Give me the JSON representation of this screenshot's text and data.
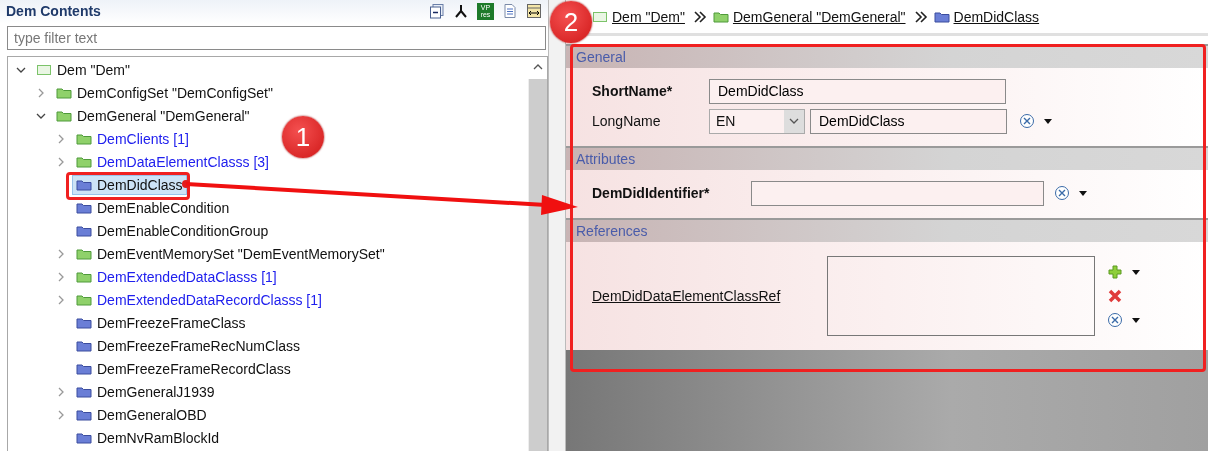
{
  "contents_panel": {
    "title": "Dem Contents",
    "toolbar_badge": [
      "VP",
      "res"
    ],
    "filter": {
      "placeholder": "type filter text"
    },
    "tree": [
      {
        "label": "Dem \"Dem\"",
        "kind": "module",
        "expanded": true,
        "linked": false,
        "selected": false,
        "children": [
          {
            "label": "DemConfigSet \"DemConfigSet\"",
            "kind": "container",
            "expanded": false,
            "linked": false,
            "selected": false
          },
          {
            "label": "DemGeneral \"DemGeneral\"",
            "kind": "container",
            "expanded": true,
            "linked": false,
            "selected": false,
            "children": [
              {
                "label": "DemClients [1]",
                "kind": "container",
                "expanded": false,
                "linked": true,
                "selected": false
              },
              {
                "label": "DemDataElementClasss [3]",
                "kind": "container",
                "expanded": false,
                "linked": true,
                "selected": false
              },
              {
                "label": "DemDidClass",
                "kind": "class",
                "linked": false,
                "selected": true
              },
              {
                "label": "DemEnableCondition",
                "kind": "class",
                "linked": false,
                "selected": false
              },
              {
                "label": "DemEnableConditionGroup",
                "kind": "class",
                "linked": false,
                "selected": false
              },
              {
                "label": "DemEventMemorySet \"DemEventMemorySet\"",
                "kind": "container",
                "expanded": false,
                "linked": false,
                "selected": false
              },
              {
                "label": "DemExtendedDataClasss [1]",
                "kind": "container",
                "expanded": false,
                "linked": true,
                "selected": false
              },
              {
                "label": "DemExtendedDataRecordClasss [1]",
                "kind": "container",
                "expanded": false,
                "linked": true,
                "selected": false
              },
              {
                "label": "DemFreezeFrameClass",
                "kind": "class",
                "linked": false,
                "selected": false
              },
              {
                "label": "DemFreezeFrameRecNumClass",
                "kind": "class",
                "linked": false,
                "selected": false
              },
              {
                "label": "DemFreezeFrameRecordClass",
                "kind": "class",
                "linked": false,
                "selected": false
              },
              {
                "label": "DemGeneralJ1939",
                "kind": "class",
                "expanded": false,
                "linked": false,
                "selected": false
              },
              {
                "label": "DemGeneralOBD",
                "kind": "class",
                "expanded": false,
                "linked": false,
                "selected": false
              },
              {
                "label": "DemNvRamBlockId",
                "kind": "class",
                "linked": false,
                "selected": false
              }
            ]
          }
        ]
      }
    ]
  },
  "editor": {
    "breadcrumb": [
      {
        "label": "Dem \"Dem\"",
        "kind": "module"
      },
      {
        "label": "DemGeneral \"DemGeneral\"",
        "kind": "container"
      },
      {
        "label": "DemDidClass",
        "kind": "class"
      }
    ],
    "sections": [
      {
        "title": "General",
        "rows": [
          {
            "kind": "text",
            "label": "ShortName*",
            "required": true,
            "value": "DemDidClass"
          },
          {
            "kind": "lang_text",
            "label": "LongName",
            "required": false,
            "language": "EN",
            "value": "DemDidClass"
          }
        ]
      },
      {
        "title": "Attributes",
        "rows": [
          {
            "kind": "number",
            "label": "DemDidIdentifier*",
            "required": true
          }
        ]
      },
      {
        "title": "References",
        "rows": [
          {
            "kind": "reference_list",
            "label": "DemDidDataElementClassRef",
            "required": false
          }
        ]
      }
    ]
  },
  "callouts": [
    {
      "label": "1"
    },
    {
      "label": "2"
    }
  ]
}
